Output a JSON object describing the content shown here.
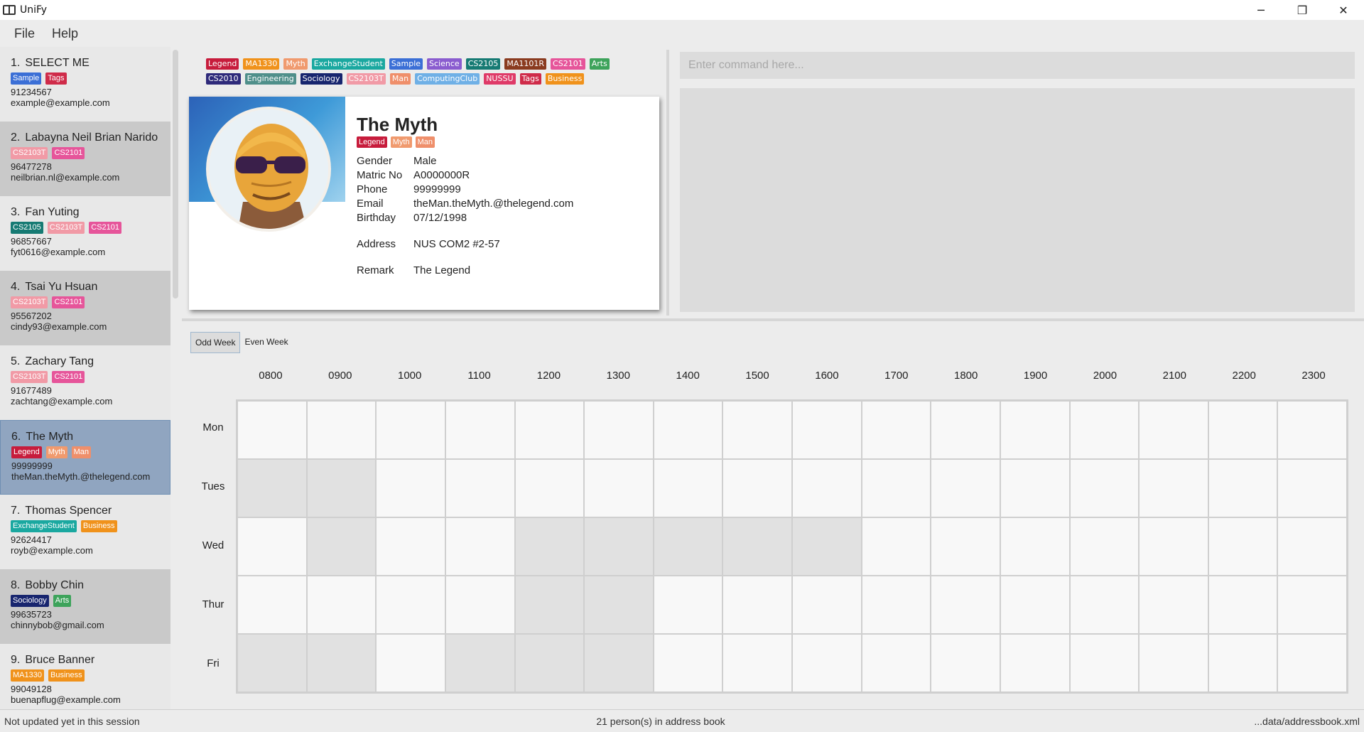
{
  "window": {
    "title": "UniFy",
    "controls": [
      "─",
      "❐",
      "✕"
    ]
  },
  "menu": [
    "File",
    "Help"
  ],
  "persons": [
    {
      "index": "1.",
      "name": "SELECT ME",
      "tags": [
        {
          "label": "Sample",
          "color": "#3b6fd6"
        },
        {
          "label": "Tags",
          "color": "#cf2b49"
        }
      ],
      "phone": "91234567",
      "email": "example@example.com"
    },
    {
      "index": "2.",
      "name": "Labayna Neil Brian Narido",
      "tags": [
        {
          "label": "CS2103T",
          "color": "#f19aa6"
        },
        {
          "label": "CS2101",
          "color": "#e6559a"
        }
      ],
      "phone": "96477278",
      "email": "neilbrian.nl@example.com"
    },
    {
      "index": "3.",
      "name": "Fan Yuting",
      "tags": [
        {
          "label": "CS2105",
          "color": "#167a73"
        },
        {
          "label": "CS2103T",
          "color": "#f19aa6"
        },
        {
          "label": "CS2101",
          "color": "#e6559a"
        }
      ],
      "phone": "96857667",
      "email": "fyt0616@example.com"
    },
    {
      "index": "4.",
      "name": "Tsai Yu Hsuan",
      "tags": [
        {
          "label": "CS2103T",
          "color": "#f19aa6"
        },
        {
          "label": "CS2101",
          "color": "#e6559a"
        }
      ],
      "phone": "95567202",
      "email": "cindy93@example.com"
    },
    {
      "index": "5.",
      "name": "Zachary Tang",
      "tags": [
        {
          "label": "CS2103T",
          "color": "#f19aa6"
        },
        {
          "label": "CS2101",
          "color": "#e6559a"
        }
      ],
      "phone": "91677489",
      "email": "zachtang@example.com"
    },
    {
      "index": "6.",
      "name": "The Myth",
      "tags": [
        {
          "label": "Legend",
          "color": "#c71c3c"
        },
        {
          "label": "Myth",
          "color": "#f09a6e"
        },
        {
          "label": "Man",
          "color": "#ef8f6b"
        }
      ],
      "phone": "99999999",
      "email": "theMan.theMyth.@thelegend.com"
    },
    {
      "index": "7.",
      "name": "Thomas Spencer",
      "tags": [
        {
          "label": "ExchangeStudent",
          "color": "#1aa8a0"
        },
        {
          "label": "Business",
          "color": "#f0921b"
        }
      ],
      "phone": "92624417",
      "email": "royb@example.com"
    },
    {
      "index": "8.",
      "name": "Bobby Chin",
      "tags": [
        {
          "label": "Sociology",
          "color": "#17256e"
        },
        {
          "label": "Arts",
          "color": "#3da35b"
        }
      ],
      "phone": "99635723",
      "email": "chinnybob@gmail.com"
    },
    {
      "index": "9.",
      "name": "Bruce Banner",
      "tags": [
        {
          "label": "MA1330",
          "color": "#f0921b"
        },
        {
          "label": "Business",
          "color": "#f0921b"
        }
      ],
      "phone": "99049128",
      "email": "buenapflug@example.com"
    }
  ],
  "selected_index": 5,
  "all_tags": [
    {
      "label": "Legend",
      "color": "#c71c3c"
    },
    {
      "label": "MA1330",
      "color": "#f0921b"
    },
    {
      "label": "Myth",
      "color": "#f09a6e"
    },
    {
      "label": "ExchangeStudent",
      "color": "#1aa8a0"
    },
    {
      "label": "Sample",
      "color": "#3b6fd6"
    },
    {
      "label": "Science",
      "color": "#8a5ccf"
    },
    {
      "label": "CS2105",
      "color": "#167a73"
    },
    {
      "label": "MA1101R",
      "color": "#8a3b1f"
    },
    {
      "label": "CS2101",
      "color": "#e6559a"
    },
    {
      "label": "Arts",
      "color": "#3da35b"
    },
    {
      "label": "CS2010",
      "color": "#2e2a7a"
    },
    {
      "label": "Engineering",
      "color": "#4f8f8a"
    },
    {
      "label": "Sociology",
      "color": "#17256e"
    },
    {
      "label": "CS2103T",
      "color": "#f19aa6"
    },
    {
      "label": "Man",
      "color": "#ef8f6b"
    },
    {
      "label": "ComputingClub",
      "color": "#6fb0e6"
    },
    {
      "label": "NUSSU",
      "color": "#df3a68"
    },
    {
      "label": "Tags",
      "color": "#cf2b49"
    },
    {
      "label": "Business",
      "color": "#f0921b"
    }
  ],
  "detail": {
    "name": "The Myth",
    "tags": [
      {
        "label": "Legend",
        "color": "#c71c3c"
      },
      {
        "label": "Myth",
        "color": "#f09a6e"
      },
      {
        "label": "Man",
        "color": "#ef8f6b"
      }
    ],
    "fields": [
      {
        "label": "Gender",
        "value": "Male"
      },
      {
        "label": "Matric No",
        "value": "A0000000R"
      },
      {
        "label": "Phone",
        "value": "99999999"
      },
      {
        "label": "Email",
        "value": "theMan.theMyth.@thelegend.com"
      },
      {
        "label": "Birthday",
        "value": "07/12/1998"
      }
    ],
    "address": {
      "label": "Address",
      "value": "NUS COM2 #2-57"
    },
    "remark": {
      "label": "Remark",
      "value": "The Legend"
    }
  },
  "command": {
    "placeholder": "Enter command here...",
    "value": ""
  },
  "result": "",
  "week_tabs": [
    "Odd Week",
    "Even Week"
  ],
  "active_week": 0,
  "timetable": {
    "hours": [
      "0800",
      "0900",
      "1000",
      "1100",
      "1200",
      "1300",
      "1400",
      "1500",
      "1600",
      "1700",
      "1800",
      "1900",
      "2000",
      "2100",
      "2200",
      "2300"
    ],
    "days": [
      "Mon",
      "Tues",
      "Wed",
      "Thur",
      "Fri"
    ],
    "busy": {
      "Mon": [],
      "Tues": [
        "0800",
        "0900"
      ],
      "Wed": [
        "0900",
        "1200",
        "1300",
        "1400",
        "1500",
        "1600"
      ],
      "Thur": [
        "1200",
        "1300"
      ],
      "Fri": [
        "0800",
        "0900",
        "1100",
        "1200",
        "1300"
      ]
    }
  },
  "status": {
    "left": "Not updated yet in this session",
    "center": "21 person(s) in address book",
    "right": "...data/addressbook.xml"
  }
}
